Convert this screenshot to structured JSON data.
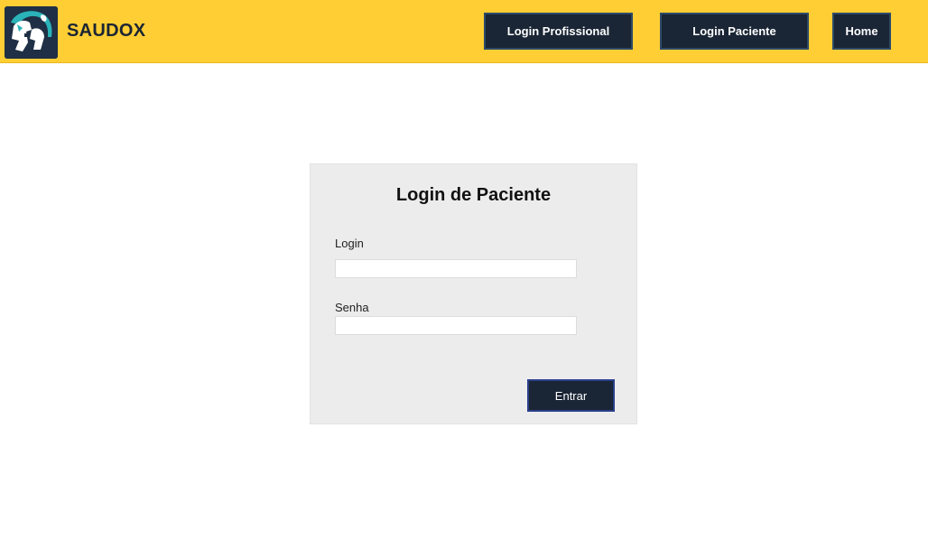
{
  "header": {
    "brand_name": "SAUDOX",
    "logo_icon": "saudox-logo-icon",
    "background_color": "#ffce34",
    "nav": {
      "login_profissional_label": "Login Profissional",
      "login_paciente_label": "Login Paciente",
      "home_label": "Home"
    },
    "nav_button_color": "#1a2535"
  },
  "login_form": {
    "title": "Login de Paciente",
    "login_label": "Login",
    "login_value": "",
    "senha_label": "Senha",
    "senha_value": "",
    "submit_label": "Entrar",
    "panel_color": "#ececec"
  }
}
